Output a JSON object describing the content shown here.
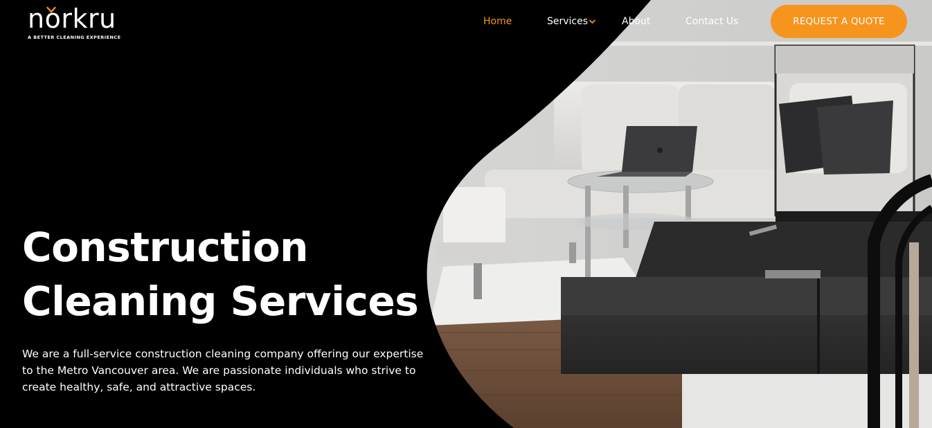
{
  "brand": {
    "name": "norkru",
    "tagline": "A BETTER CLEANING EXPERIENCE",
    "accent_color": "#f7941d"
  },
  "nav": {
    "items": [
      {
        "label": "Home",
        "active": true
      },
      {
        "label": "Services",
        "active": false,
        "has_dropdown": true
      },
      {
        "label": "About",
        "active": false
      },
      {
        "label": "Contact Us",
        "active": false
      }
    ],
    "cta_label": "REQUEST A QUOTE"
  },
  "hero": {
    "title_line1": "Construction",
    "title_line2": "Cleaning Services",
    "description": "We are a full-service construction cleaning company offering our expertise to the Metro Vancouver area. We are passionate individuals who strive to create healthy, safe, and attractive spaces."
  },
  "icons": {
    "logo_mark": "checkmark-icon",
    "services_dropdown": "chevron-down-icon"
  }
}
